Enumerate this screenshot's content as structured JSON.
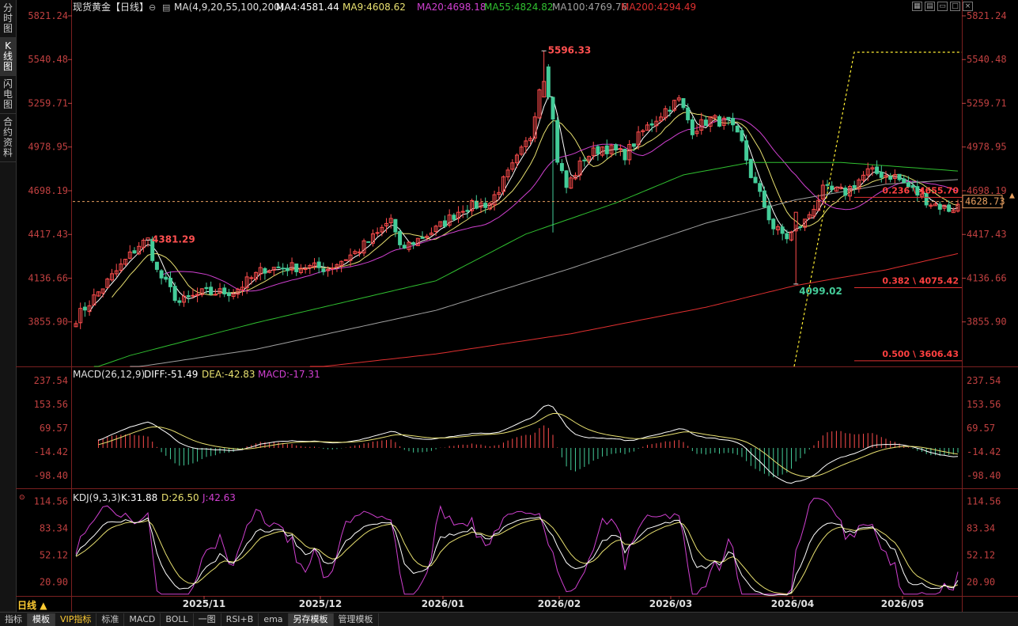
{
  "sidebar": {
    "tabs": [
      {
        "label": "分时图",
        "active": false
      },
      {
        "label": "K线图",
        "active": true
      },
      {
        "label": "闪电图",
        "active": false
      },
      {
        "label": "合约资料",
        "active": false
      }
    ]
  },
  "header": {
    "title": "现货黄金【日线】",
    "ma_params": "MA(4,9,20,55,100,200)",
    "ma_values": [
      {
        "label": "MA4:4581.44",
        "color": "#ffffff"
      },
      {
        "label": "MA9:4608.62",
        "color": "#e8e070"
      },
      {
        "label": "MA20:4698.18",
        "color": "#d040d0"
      },
      {
        "label": "MA55:4824.82",
        "color": "#30c030"
      },
      {
        "label": "MA100:4769.76",
        "color": "#a0a0a0"
      },
      {
        "label": "MA200:4294.49",
        "color": "#e03030"
      }
    ]
  },
  "colors": {
    "up": "#ff4d4d",
    "down": "#44cc99",
    "grid": "#5a1a1a",
    "axis_text": "#c04040"
  },
  "bottom_toolbar": {
    "period": "日线",
    "tabs": [
      {
        "label": "指标",
        "active": false,
        "vip": false
      },
      {
        "label": "模板",
        "active": true,
        "vip": false
      },
      {
        "label": "VIP指标",
        "active": false,
        "vip": true
      },
      {
        "label": "标准",
        "active": false,
        "vip": false
      },
      {
        "label": "MACD",
        "active": false,
        "vip": false
      },
      {
        "label": "BOLL",
        "active": false,
        "vip": false
      },
      {
        "label": "一图",
        "active": false,
        "vip": false
      },
      {
        "label": "RSI+B",
        "active": false,
        "vip": false
      },
      {
        "label": "ema",
        "active": false,
        "vip": false
      },
      {
        "label": "另存模板",
        "active": true,
        "vip": false
      },
      {
        "label": "管理模板",
        "active": false,
        "vip": false
      }
    ]
  },
  "chart_data": [
    {
      "type": "candlestick",
      "x_tick_labels": [
        "2025/11",
        "2025/12",
        "2026/01",
        "2026/02",
        "2026/03",
        "2026/04",
        "2026/05"
      ],
      "y_tick_labels": [
        "5821.24",
        "5540.48",
        "5259.71",
        "4978.95",
        "4698.19",
        "4417.43",
        "4136.66",
        "3855.90"
      ],
      "ylim": [
        3570,
        5821.24
      ],
      "current_price": "4628.73",
      "annotations": [
        {
          "label": "5596.33",
          "kind": "high"
        },
        {
          "label": "4381.29",
          "kind": "high"
        },
        {
          "label": "4099.02",
          "kind": "low"
        }
      ],
      "fibonacci": [
        {
          "label": "0.236 \\ 4655.70",
          "value": 4655.7
        },
        {
          "label": "0.382 \\ 4075.42",
          "value": 4075.42
        },
        {
          "label": "0.500 \\ 3606.43",
          "value": 3606.43
        }
      ],
      "anchors": [
        {
          "d": 0,
          "p": 3880
        },
        {
          "d": 6,
          "p": 4080
        },
        {
          "d": 14,
          "p": 4350
        },
        {
          "d": 16,
          "p": 4381.29
        },
        {
          "d": 18,
          "p": 4180
        },
        {
          "d": 23,
          "p": 3980
        },
        {
          "d": 28,
          "p": 4040
        },
        {
          "d": 35,
          "p": 4050
        },
        {
          "d": 42,
          "p": 4200
        },
        {
          "d": 50,
          "p": 4210
        },
        {
          "d": 56,
          "p": 4200
        },
        {
          "d": 62,
          "p": 4300
        },
        {
          "d": 67,
          "p": 4420
        },
        {
          "d": 70,
          "p": 4520
        },
        {
          "d": 72,
          "p": 4320
        },
        {
          "d": 75,
          "p": 4370
        },
        {
          "d": 80,
          "p": 4450
        },
        {
          "d": 86,
          "p": 4590
        },
        {
          "d": 92,
          "p": 4620
        },
        {
          "d": 97,
          "p": 4850
        },
        {
          "d": 101,
          "p": 5050
        },
        {
          "d": 104,
          "p": 5520
        },
        {
          "d": 106,
          "p": 5150
        },
        {
          "d": 107,
          "p": 4900
        },
        {
          "d": 109,
          "p": 4720
        },
        {
          "d": 113,
          "p": 4910
        },
        {
          "d": 117,
          "p": 4980
        },
        {
          "d": 122,
          "p": 4930
        },
        {
          "d": 126,
          "p": 5080
        },
        {
          "d": 131,
          "p": 5220
        },
        {
          "d": 134,
          "p": 5280
        },
        {
          "d": 137,
          "p": 5090
        },
        {
          "d": 141,
          "p": 5160
        },
        {
          "d": 145,
          "p": 5130
        },
        {
          "d": 148,
          "p": 5000
        },
        {
          "d": 150,
          "p": 4800
        },
        {
          "d": 153,
          "p": 4600
        },
        {
          "d": 155,
          "p": 4460
        },
        {
          "d": 158,
          "p": 4400
        },
        {
          "d": 162,
          "p": 4500
        },
        {
          "d": 166,
          "p": 4700
        },
        {
          "d": 171,
          "p": 4690
        },
        {
          "d": 176,
          "p": 4820
        },
        {
          "d": 182,
          "p": 4790
        },
        {
          "d": 186,
          "p": 4700
        },
        {
          "d": 190,
          "p": 4620
        },
        {
          "d": 194,
          "p": 4580
        },
        {
          "d": 196,
          "p": 4600
        }
      ],
      "ma": [
        {
          "name": "MA4",
          "color": "#ffffff",
          "window": 4
        },
        {
          "name": "MA9",
          "color": "#e8e070",
          "window": 9
        },
        {
          "name": "MA20",
          "color": "#d040d0",
          "window": 20
        },
        {
          "name": "MA55",
          "color": "#30c030",
          "points": [
            {
              "d": 4,
              "p": 3560
            },
            {
              "d": 12,
              "p": 3640
            },
            {
              "d": 40,
              "p": 3850
            },
            {
              "d": 80,
              "p": 4120
            },
            {
              "d": 100,
              "p": 4420
            },
            {
              "d": 120,
              "p": 4620
            },
            {
              "d": 135,
              "p": 4800
            },
            {
              "d": 150,
              "p": 4880
            },
            {
              "d": 170,
              "p": 4880
            },
            {
              "d": 196,
              "p": 4824.82
            }
          ]
        },
        {
          "name": "MA100",
          "color": "#a0a0a0",
          "points": [
            {
              "d": 12,
              "p": 3560
            },
            {
              "d": 40,
              "p": 3680
            },
            {
              "d": 80,
              "p": 3930
            },
            {
              "d": 110,
              "p": 4200
            },
            {
              "d": 140,
              "p": 4490
            },
            {
              "d": 160,
              "p": 4640
            },
            {
              "d": 180,
              "p": 4740
            },
            {
              "d": 196,
              "p": 4769.76
            }
          ]
        },
        {
          "name": "MA200",
          "color": "#e03030",
          "points": [
            {
              "d": 52,
              "p": 3560
            },
            {
              "d": 80,
              "p": 3650
            },
            {
              "d": 110,
              "p": 3780
            },
            {
              "d": 140,
              "p": 3950
            },
            {
              "d": 160,
              "p": 4090
            },
            {
              "d": 180,
              "p": 4190
            },
            {
              "d": 196,
              "p": 4294.49
            }
          ]
        }
      ]
    },
    {
      "type": "macd",
      "title": "MACD(26,12,9)",
      "diff": "DIFF:-51.49",
      "dea": "DEA:-42.83",
      "macd": "MACD:-17.31",
      "ylim": [
        -140,
        280
      ],
      "y_tick_labels": [
        "237.54",
        "153.56",
        "69.57",
        "-14.42",
        "-98.40"
      ]
    },
    {
      "type": "kdj",
      "title": "KDJ(9,3,3)",
      "k": "K:31.88",
      "d": "D:26.50",
      "j": "J:42.63",
      "ylim": [
        5,
        125
      ],
      "y_tick_labels": [
        "114.56",
        "83.34",
        "52.12",
        "20.90"
      ]
    }
  ]
}
